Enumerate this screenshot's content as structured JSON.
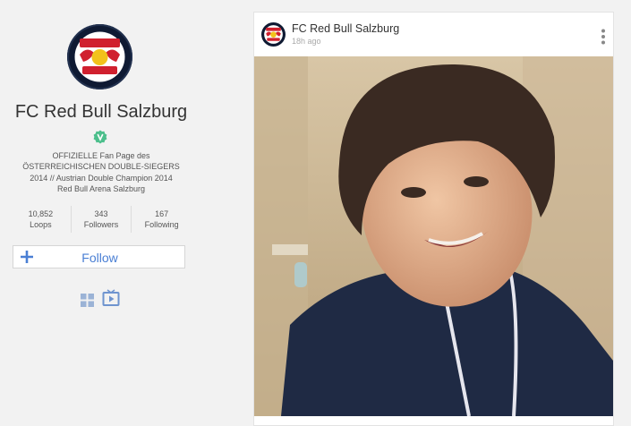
{
  "profile": {
    "name": "FC Red Bull Salzburg",
    "avatar_icon": "red-bull-salzburg-logo",
    "verified_icon": "verified-badge-icon",
    "bio": [
      "OFFIZIELLE Fan Page des",
      "ÖSTERREICHISCHEN DOUBLE-SIEGERS",
      "2014 // Austrian Double Champion 2014",
      "Red Bull Arena Salzburg"
    ],
    "stats": [
      {
        "value": "10,852",
        "label": "Loops"
      },
      {
        "value": "343",
        "label": "Followers"
      },
      {
        "value": "167",
        "label": "Following"
      }
    ],
    "follow_label": "Follow",
    "view_icons": [
      "grid-view-icon",
      "video-view-icon"
    ]
  },
  "post": {
    "author": "FC Red Bull Salzburg",
    "time": "18h ago",
    "menu_icon": "more-vertical-icon"
  },
  "colors": {
    "accent": "#4a7fd4",
    "verified": "#4cbf8c",
    "background": "#f2f2f2"
  }
}
